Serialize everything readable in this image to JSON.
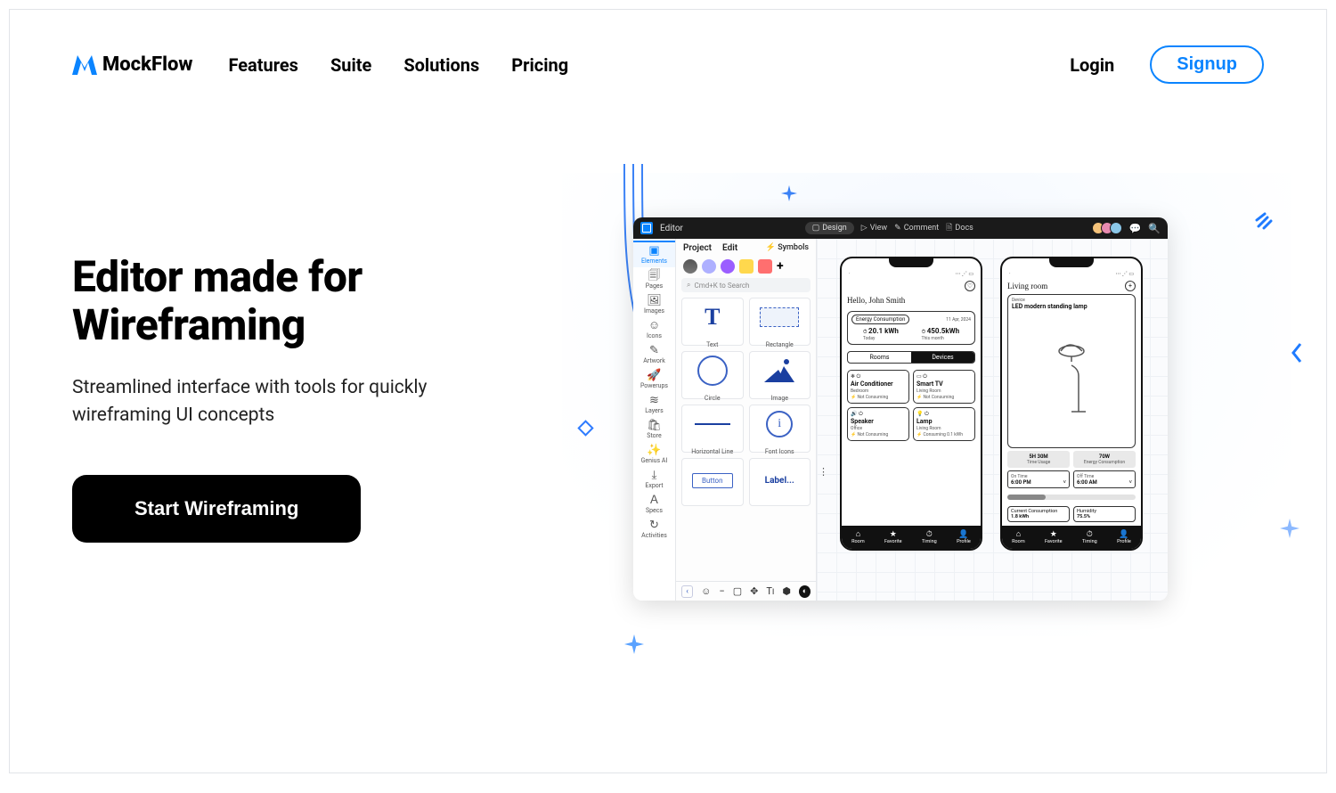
{
  "nav": {
    "brand": "MockFlow",
    "items": [
      "Features",
      "Suite",
      "Solutions",
      "Pricing"
    ],
    "login": "Login",
    "signup": "Signup"
  },
  "hero": {
    "title_l1": "Editor made for",
    "title_l2": "Wireframing",
    "subtitle": "Streamlined interface with tools for quickly wireframing UI concepts",
    "cta": "Start Wireframing"
  },
  "editor": {
    "title": "Editor",
    "top": {
      "design": "Design",
      "view": "View",
      "comment": "Comment",
      "docs": "Docs"
    },
    "rail": [
      "Elements",
      "Pages",
      "Images",
      "Icons",
      "Artwork",
      "Powerups",
      "Layers",
      "Store",
      "Genius AI",
      "Export",
      "Specs",
      "Activities"
    ],
    "pal": {
      "tab1": "Project",
      "tab2": "Edit",
      "symbols": "Symbols",
      "search": "Cmd+K to Search",
      "cells": [
        "Text",
        "Rectangle",
        "Circle",
        "Image",
        "Horizontal Line",
        "Font Icons",
        "Button",
        "Label..."
      ]
    },
    "phone1": {
      "title": "Hello, John Smith",
      "ec": "Energy Consumption",
      "ec_date": "11 Apr, 2024",
      "k1": "20.1 kWh",
      "k1s": "Today",
      "k2": "450.5kWh",
      "k2s": "This month",
      "seg1": "Rooms",
      "seg2": "Devices",
      "dev": [
        {
          "n": "Air Conditioner",
          "r": "Bedroom",
          "s": "Not Consuming"
        },
        {
          "n": "Smart TV",
          "r": "Living Room",
          "s": "Not Consuming"
        },
        {
          "n": "Speaker",
          "r": "Office",
          "s": "Not Consuming"
        },
        {
          "n": "Lamp",
          "r": "Living Room",
          "s": "Consuming 0.1 kWh"
        }
      ],
      "nav": [
        "Room",
        "Favorite",
        "Timing",
        "Profile"
      ]
    },
    "phone2": {
      "title": "Living room",
      "device": "Device",
      "devname": "LED modern standing lamp",
      "b1": "5H 30M",
      "b1s": "Time Usage",
      "b2": "70W",
      "b2s": "Energy Consumption",
      "t1l": "On Time",
      "t1v": "6:00 PM",
      "t2l": "Off Time",
      "t2v": "6:00 AM",
      "s1l": "Current Consumption",
      "s1v": "1.8 kWh",
      "s2l": "Humidity",
      "s2v": "75.5%",
      "nav": [
        "Room",
        "Favorite",
        "Timing",
        "Profile"
      ]
    }
  }
}
